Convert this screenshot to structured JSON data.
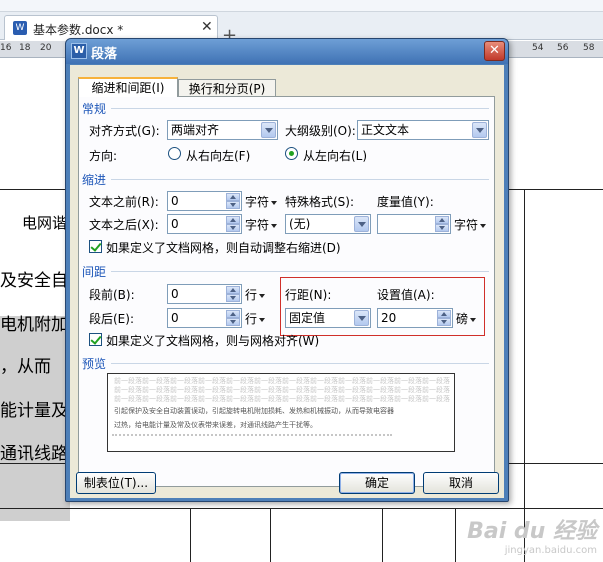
{
  "document": {
    "tab_title": "基本参数.docx *",
    "tab_icon": "W",
    "close_tab": "✕",
    "new_tab": "+",
    "ruler_numbers": [
      "16",
      "18",
      "20",
      "54",
      "56",
      "58"
    ],
    "visible_text": [
      "电网谐",
      "及安全自",
      "电机附加",
      "，从而",
      "能计量及",
      "通讯线路"
    ],
    "watermark": "Bai du 经验",
    "watermark_url": "jingyan.baidu.com"
  },
  "dialog": {
    "title": "段落",
    "title_icon": "W",
    "close_label": "✕",
    "tabs": [
      {
        "label": "缩进和间距(I)",
        "active": true
      },
      {
        "label": "换行和分页(P)",
        "active": false
      }
    ],
    "general": {
      "heading": "常规",
      "alignment_label": "对齐方式(G):",
      "alignment_value": "两端对齐",
      "outline_label": "大纲级别(O):",
      "outline_value": "正文文本",
      "direction_label": "方向:",
      "rtl_label": "从右向左(F)",
      "ltr_label": "从左向右(L)",
      "direction_selected": "ltr"
    },
    "indent": {
      "heading": "缩进",
      "before_label": "文本之前(R):",
      "before_value": "0",
      "before_unit": "字符",
      "after_label": "文本之后(X):",
      "after_value": "0",
      "after_unit": "字符",
      "special_label": "特殊格式(S):",
      "special_value": "(无)",
      "measure_label": "度量值(Y):",
      "measure_value": "",
      "measure_unit": "字符",
      "grid_checkbox_label": "如果定义了文档网格，则自动调整右缩进(D)",
      "grid_checked": true
    },
    "spacing": {
      "heading": "间距",
      "before_label": "段前(B):",
      "before_value": "0",
      "before_unit": "行",
      "after_label": "段后(E):",
      "after_value": "0",
      "after_unit": "行",
      "line_spacing_label": "行距(N):",
      "line_spacing_value": "固定值",
      "set_value_label": "设置值(A):",
      "set_value": "20",
      "set_value_unit": "磅",
      "grid_checkbox_label": "如果定义了文档网格，则与网格对齐(W)",
      "grid_checked": true
    },
    "preview": {
      "heading": "预览",
      "prev_paragraph": "前一段落前一段落前一段落前一段落前一段落前一段落前一段落前一段落前一段落前一段落前一段落前一段落",
      "line1": "引起保护及安全自动装置误动，引起旋转电机附加损耗、发热和机械振动，从而导致电容器",
      "line2": "过热，给电能计量及常及仪表带来误差，对通讯线路产生干扰等。"
    },
    "buttons": {
      "tabs_label": "制表位(T)...",
      "ok_label": "确定",
      "cancel_label": "取消"
    },
    "colors": {
      "section_heading": "#1d56b8",
      "highlight_box": "#d0302a",
      "title_bar": "#3f72b4"
    }
  }
}
